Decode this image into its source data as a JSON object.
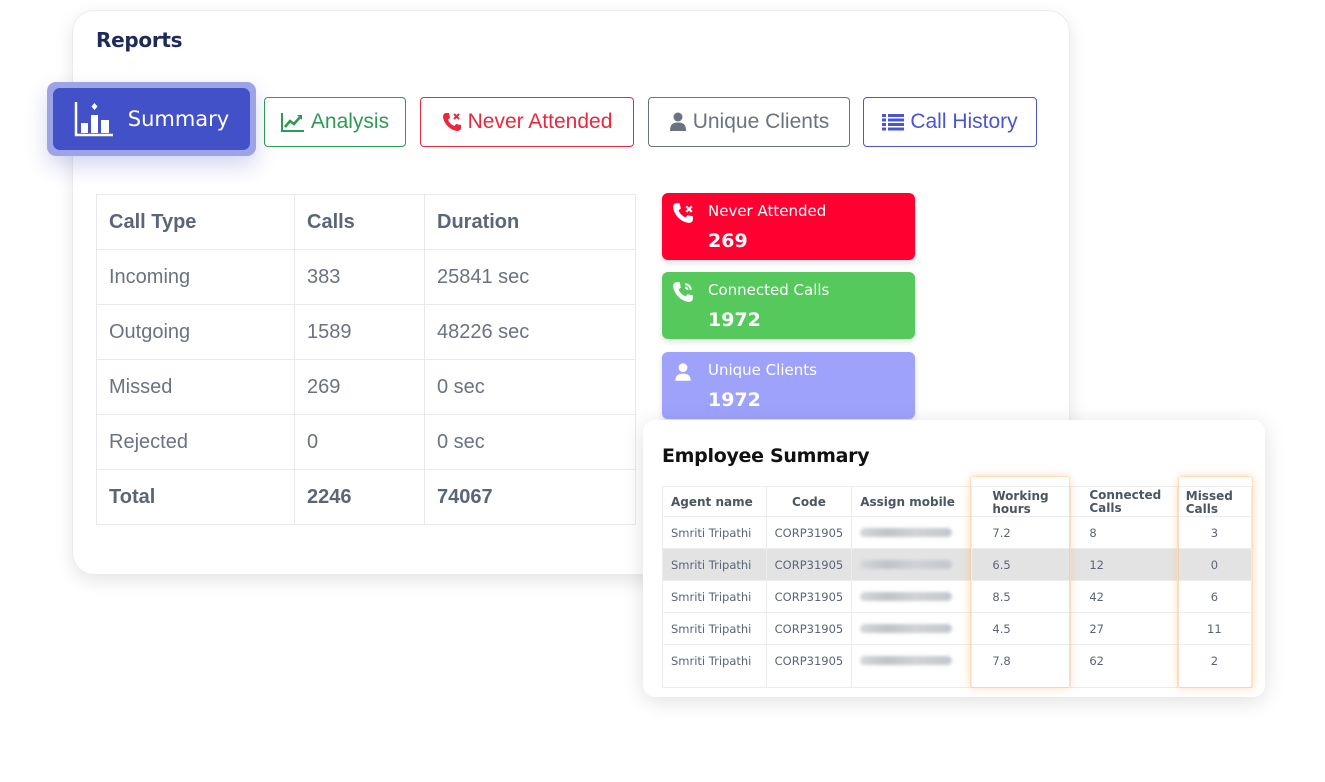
{
  "page": {
    "title": "Reports"
  },
  "tabs": [
    {
      "label": "Summary",
      "icon": "bar-chart-icon",
      "active": true
    },
    {
      "label": "Analysis",
      "icon": "line-chart-icon",
      "color": "#2e9a55"
    },
    {
      "label": "Never Attended",
      "icon": "phone-missed-icon",
      "color": "#e8283e"
    },
    {
      "label": "Unique Clients",
      "icon": "user-icon",
      "color": "#6b7280"
    },
    {
      "label": "Call History",
      "icon": "list-icon",
      "color": "#4a55d1"
    }
  ],
  "call_table": {
    "headers": [
      "Call Type",
      "Calls",
      "Duration"
    ],
    "rows": [
      {
        "type": "Incoming",
        "calls": "383",
        "duration": "25841 sec"
      },
      {
        "type": "Outgoing",
        "calls": "1589",
        "duration": "48226 sec"
      },
      {
        "type": "Missed",
        "calls": "269",
        "duration": "0 sec"
      },
      {
        "type": "Rejected",
        "calls": "0",
        "duration": "0 sec"
      }
    ],
    "total": {
      "type": "Total",
      "calls": "2246",
      "duration": "74067"
    }
  },
  "stats": [
    {
      "label": "Never Attended",
      "value": "269",
      "icon": "phone-missed-icon",
      "color": "#ff0030"
    },
    {
      "label": "Connected Calls",
      "value": "1972",
      "icon": "phone-ringing-icon",
      "color": "#55c95c"
    },
    {
      "label": "Unique Clients",
      "value": "1972",
      "icon": "user-icon",
      "color": "#9ea2fb"
    }
  ],
  "employee_summary": {
    "title": "Employee Summary",
    "headers": {
      "agent": "Agent name",
      "code": "Code",
      "mobile": "Assign mobile",
      "working_1": "Working",
      "working_2": "hours",
      "connected_1": "Connected",
      "connected_2": "Calls",
      "missed_1": "Missed",
      "missed_2": "Calls"
    },
    "rows": [
      {
        "agent": "Smriti Tripathi",
        "code": "CORP31905",
        "hours": "7.2",
        "connected": "8",
        "missed": "3"
      },
      {
        "agent": "Smriti Tripathi",
        "code": "CORP31905",
        "hours": "6.5",
        "connected": "12",
        "missed": "0"
      },
      {
        "agent": "Smriti Tripathi",
        "code": "CORP31905",
        "hours": "8.5",
        "connected": "42",
        "missed": "6"
      },
      {
        "agent": "Smriti Tripathi",
        "code": "CORP31905",
        "hours": "4.5",
        "connected": "27",
        "missed": "11"
      },
      {
        "agent": "Smriti Tripathi",
        "code": "CORP31905",
        "hours": "7.8",
        "connected": "62",
        "missed": "2"
      }
    ]
  }
}
